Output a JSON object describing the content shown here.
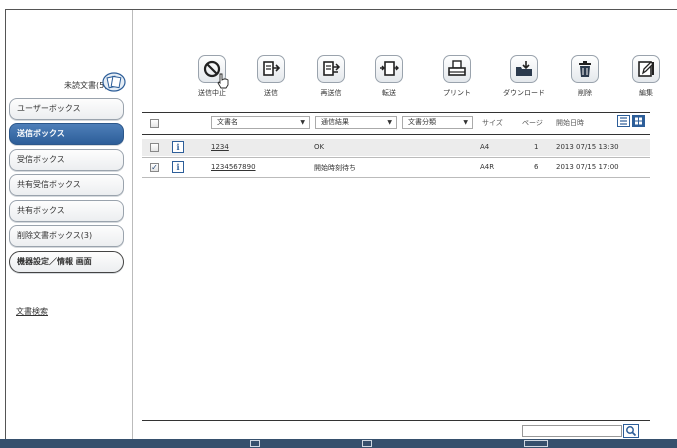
{
  "sidebar": {
    "unread_label": "未読文書(5)",
    "items": [
      {
        "label": "ユーザーボックス",
        "active": false
      },
      {
        "label": "送信ボックス",
        "active": true
      },
      {
        "label": "受信ボックス",
        "active": false
      },
      {
        "label": "共有受信ボックス",
        "active": false
      },
      {
        "label": "共有ボックス",
        "active": false
      },
      {
        "label": "削除文書ボックス(3)",
        "active": false
      },
      {
        "label": "機器設定／情報 画面",
        "active": false
      }
    ],
    "search_link": "文書検索"
  },
  "toolbar": {
    "buttons": [
      {
        "label": "送信中止",
        "icon": "cancel-icon"
      },
      {
        "label": "送信",
        "icon": "send-icon"
      },
      {
        "label": "再送信",
        "icon": "resend-icon"
      },
      {
        "label": "転送",
        "icon": "forward-icon"
      },
      {
        "label": "プリント",
        "icon": "print-icon"
      },
      {
        "label": "ダウンロード",
        "icon": "download-icon"
      },
      {
        "label": "削除",
        "icon": "trash-icon"
      },
      {
        "label": "編集",
        "icon": "edit-icon"
      }
    ]
  },
  "list": {
    "filters": {
      "doc_name": "文書名",
      "result": "通信結果",
      "category": "文書分類"
    },
    "headers": {
      "size": "サイズ",
      "pages": "ページ",
      "start": "開始日時"
    },
    "rows": [
      {
        "name": "1234",
        "result": "OK",
        "size": "A4",
        "pages": "1",
        "start": "2013 07/15 13:30",
        "checked": false
      },
      {
        "name": "1234567890",
        "result": "開始時刻待ち",
        "size": "A4R",
        "pages": "6",
        "start": "2013 07/15 17:00",
        "checked": true
      }
    ]
  },
  "colors": {
    "accent": "#2d5e99",
    "bottom_bar": "#36506d"
  }
}
